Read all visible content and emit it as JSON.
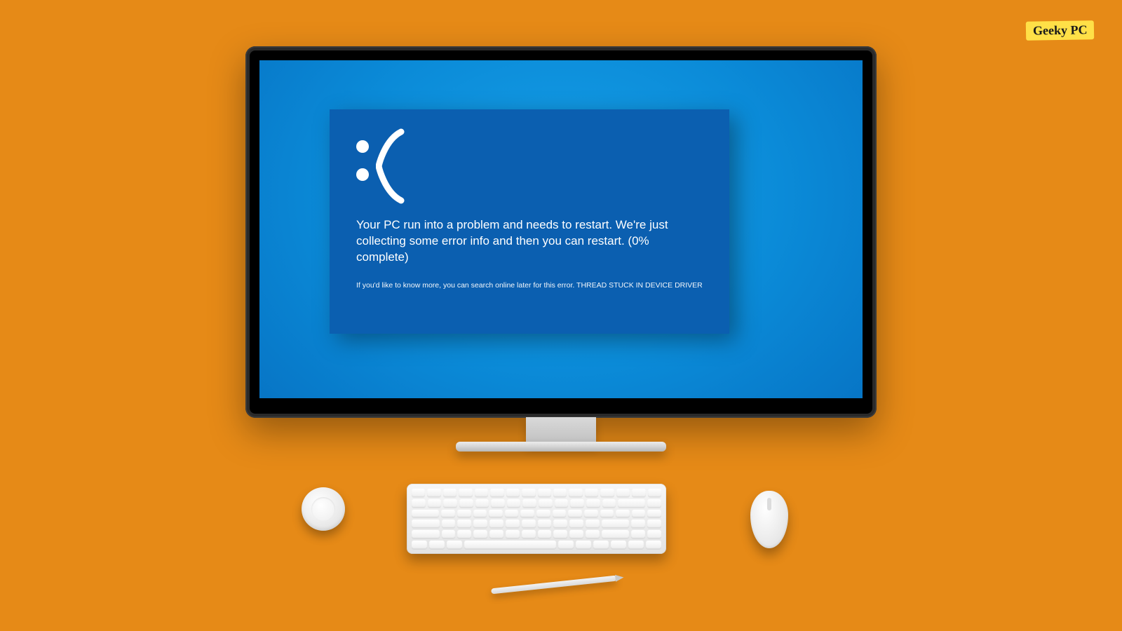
{
  "watermark": {
    "text": "Geeky PC"
  },
  "bsod": {
    "emoticon": ":(",
    "message": "Your PC run into a problem and needs to restart. We're just collecting some error info and then you can restart. (0% complete)",
    "more_info": "If you'd like to know more, you can search online later for this error. THREAD STUCK IN DEVICE DRIVER"
  },
  "colors": {
    "background": "#e68a17",
    "bsod_panel": "#0b5fb0",
    "screen_gradient_center": "#16a0e8",
    "watermark_bg": "#ffe047"
  }
}
